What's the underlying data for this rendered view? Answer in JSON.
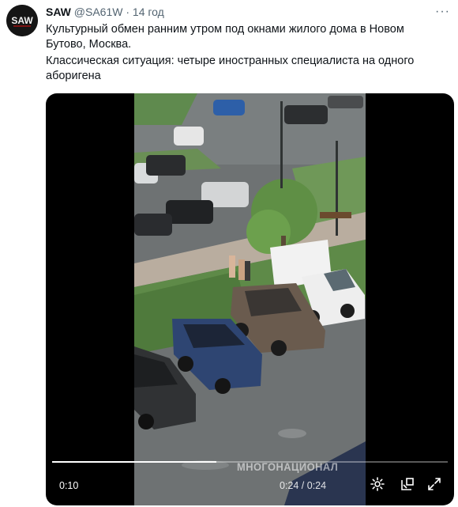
{
  "tweet": {
    "author_name": "SAW",
    "author_handle": "@SA61W",
    "separator": "·",
    "time": "14 год",
    "text_line1": "Культурный обмен ранним утром под окнами жилого дома в Новом Бутово, Москва.",
    "text_line2": "Классическая ситуация: четыре иностранных специалиста на одного аборигена",
    "more_label": "···",
    "avatar_text": "SAW"
  },
  "video": {
    "watermark": "МНОГОНАЦИОНАЛ",
    "current_time": "0:10",
    "timestamp_overlay": "0:24 / 0:24",
    "progress": 0.415
  },
  "colors": {
    "text": "#0f1419",
    "secondary": "#536471",
    "avatar_bg": "#111111"
  },
  "icons": {
    "settings": "gear-icon",
    "pip": "picture-in-picture-icon",
    "fullscreen": "fullscreen-icon"
  }
}
